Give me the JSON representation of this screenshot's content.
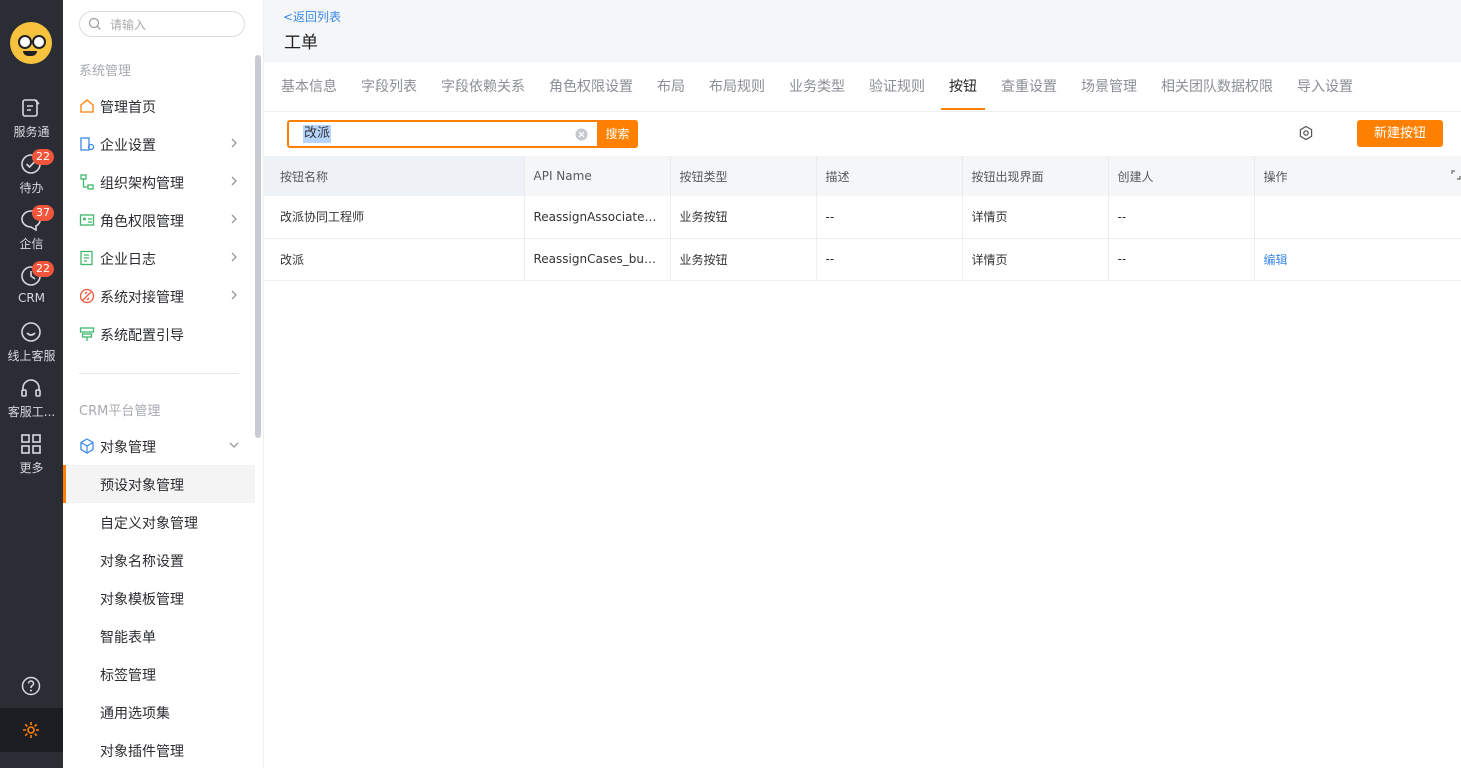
{
  "rail": {
    "items": [
      {
        "label": "服务通",
        "icon": "service-icon"
      },
      {
        "label": "待办",
        "icon": "todo-icon",
        "badge": "22"
      },
      {
        "label": "企信",
        "icon": "chat-icon",
        "badge": "37"
      },
      {
        "label": "CRM",
        "icon": "crm-clock-icon",
        "badge": "22"
      },
      {
        "label": "线上客服",
        "icon": "online-service-icon"
      },
      {
        "label": "客服工...",
        "icon": "headset-icon"
      },
      {
        "label": "更多",
        "icon": "grid-icon"
      }
    ]
  },
  "sidebar": {
    "search_placeholder": "请输入",
    "group1_title": "系统管理",
    "group1_items": [
      {
        "label": "管理首页",
        "icon": "home-icon"
      },
      {
        "label": "企业设置",
        "icon": "enterprise-icon"
      },
      {
        "label": "组织架构管理",
        "icon": "org-icon"
      },
      {
        "label": "角色权限管理",
        "icon": "role-icon"
      },
      {
        "label": "企业日志",
        "icon": "log-icon"
      },
      {
        "label": "系统对接管理",
        "icon": "integration-icon"
      },
      {
        "label": "系统配置引导",
        "icon": "guide-icon"
      }
    ],
    "group2_title": "CRM平台管理",
    "object_mgmt_label": "对象管理",
    "sub_items": [
      "预设对象管理",
      "自定义对象管理",
      "对象名称设置",
      "对象模板管理",
      "智能表单",
      "标签管理",
      "通用选项集",
      "对象插件管理"
    ]
  },
  "header": {
    "back_link": "<返回列表",
    "title": "工单"
  },
  "tabs": [
    "基本信息",
    "字段列表",
    "字段依赖关系",
    "角色权限设置",
    "布局",
    "布局规则",
    "业务类型",
    "验证规则",
    "按钮",
    "查重设置",
    "场景管理",
    "相关团队数据权限",
    "导入设置"
  ],
  "active_tab": "按钮",
  "search": {
    "value": "改派",
    "button": "搜索"
  },
  "new_button": "新建按钮",
  "table": {
    "columns": [
      "按钮名称",
      "API Name",
      "按钮类型",
      "描述",
      "按钮出现界面",
      "创建人",
      "操作"
    ],
    "rows": [
      {
        "name": "改派协同工程师",
        "api": "ReassignAssociateE…",
        "type": "业务按钮",
        "desc": "--",
        "ui": "详情页",
        "creator": "--",
        "action": ""
      },
      {
        "name": "改派",
        "api": "ReassignCases_butt…",
        "type": "业务按钮",
        "desc": "--",
        "ui": "详情页",
        "creator": "--",
        "action": "编辑"
      }
    ]
  },
  "colors": {
    "accent": "#ff8000",
    "link": "#3b8ae6",
    "rail_bg": "#2a2d34"
  }
}
